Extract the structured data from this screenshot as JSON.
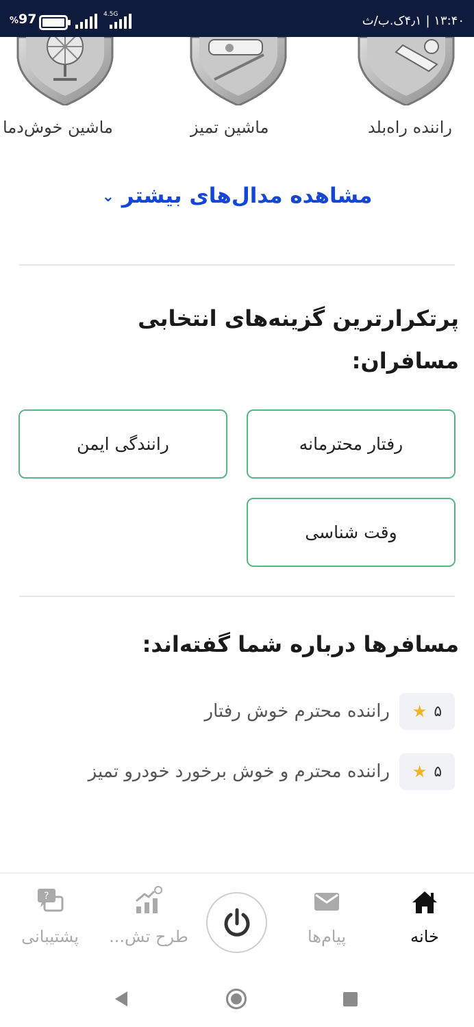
{
  "status_bar": {
    "battery_percent": "97",
    "battery_suffix": "%",
    "network_type": "4.5G",
    "time": "۱۳:۴۰ | ۴٫۱ک.ب/ث"
  },
  "medals": [
    {
      "label": "راننده راه‌بلد",
      "icon": "medal-shield-icon"
    },
    {
      "label": "ماشین تمیز",
      "icon": "medal-shield-icon"
    },
    {
      "label": "ماشین خوش‌دما",
      "icon": "medal-shield-icon"
    }
  ],
  "more_medals_link": {
    "label": "مشاهده مدال‌های بیشتر",
    "icon": "chevron-down-icon",
    "color": "#1447d6"
  },
  "top_choices": {
    "title": "پرتکرارترین گزینه‌های انتخابی مسافران:",
    "items": [
      "رفتار محترمانه",
      "رانندگی ایمن",
      "وقت شناسی"
    ],
    "border_color": "#5ab582"
  },
  "reviews": {
    "title": "مسافرها درباره شما گفته‌اند:",
    "items": [
      {
        "rating": "۵",
        "text": "راننده محترم خوش رفتار"
      },
      {
        "rating": "۵",
        "text": "راننده محترم و خوش برخورد خودرو تمیز"
      }
    ],
    "star_color": "#f0b429"
  },
  "bottom_nav": {
    "items": [
      {
        "label": "خانه",
        "icon": "home-icon",
        "active": true
      },
      {
        "label": "پیام‌ها",
        "icon": "mail-icon",
        "active": false
      },
      {
        "label": "",
        "icon": "power-icon",
        "active": false
      },
      {
        "label": "طرح تش...",
        "icon": "growth-chart-icon",
        "active": false
      },
      {
        "label": "پشتیبانی",
        "icon": "support-chat-icon",
        "active": false
      }
    ]
  },
  "system_nav": {
    "back": "back-icon",
    "home": "home-circle-icon",
    "recents": "recents-icon"
  }
}
